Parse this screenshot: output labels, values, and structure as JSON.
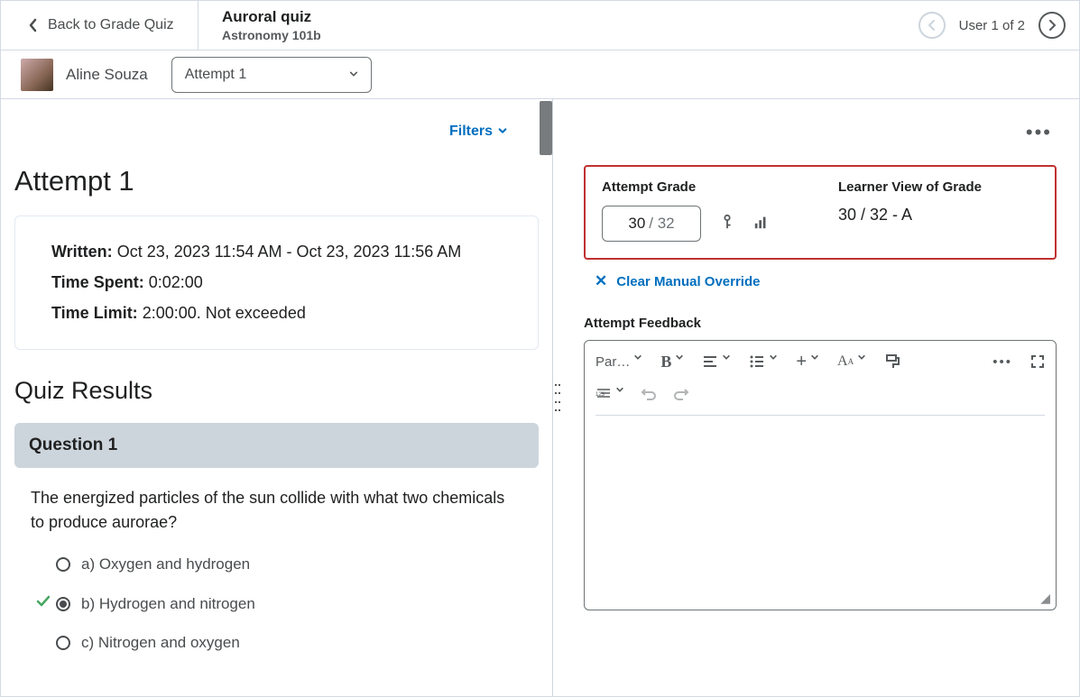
{
  "header": {
    "back_label": "Back to Grade Quiz",
    "quiz_title": "Auroral quiz",
    "course_name": "Astronomy 101b",
    "user_counter": "User 1 of 2"
  },
  "subheader": {
    "student_name": "Aline Souza",
    "attempt_selector": "Attempt 1"
  },
  "left": {
    "filters_label": "Filters",
    "attempt_heading": "Attempt 1",
    "info": {
      "written_label": "Written:",
      "written_value": "Oct 23, 2023 11:54 AM - Oct 23, 2023 11:56 AM",
      "timespent_label": "Time Spent:",
      "timespent_value": "0:02:00",
      "timelimit_label": "Time Limit:",
      "timelimit_value": "2:00:00. Not exceeded"
    },
    "results_heading": "Quiz Results",
    "question": {
      "header": "Question 1",
      "text": "The energized particles of the sun collide with what two chemicals to produce aurorae?",
      "options": [
        {
          "label": "a) Oxygen and hydrogen",
          "selected": false,
          "correct": false
        },
        {
          "label": "b) Hydrogen and nitrogen",
          "selected": true,
          "correct": true
        },
        {
          "label": "c) Nitrogen and oxygen",
          "selected": false,
          "correct": false
        }
      ]
    }
  },
  "right": {
    "attempt_grade_label": "Attempt Grade",
    "grade_value": "30",
    "grade_denominator": "/ 32",
    "learner_view_label": "Learner View of Grade",
    "learner_view_value": "30 / 32 - A",
    "clear_override_label": "Clear Manual Override",
    "feedback_label": "Attempt Feedback",
    "toolbar": {
      "paragraph": "Par…"
    }
  }
}
